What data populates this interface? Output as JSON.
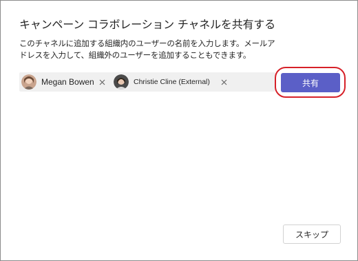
{
  "dialog": {
    "title": "キャンペーン コラボレーション チャネルを共有する",
    "description": "このチャネルに追加する組織内のユーザーの名前を入力します。メールアドレスを入力して、組織外のユーザーを追加することもできます。"
  },
  "people_picker": {
    "chips": [
      {
        "name": "Megan Bowen",
        "avatar": "person-photo",
        "remove_icon": "close-icon"
      },
      {
        "name": "Christie Cline (External)",
        "avatar": "person-photo",
        "remove_icon": "close-icon"
      }
    ]
  },
  "buttons": {
    "share_label": "共有",
    "skip_label": "スキップ"
  },
  "colors": {
    "accent": "#5b5fc7",
    "highlight": "#d62028",
    "picker_bg": "#f0f0f0"
  }
}
